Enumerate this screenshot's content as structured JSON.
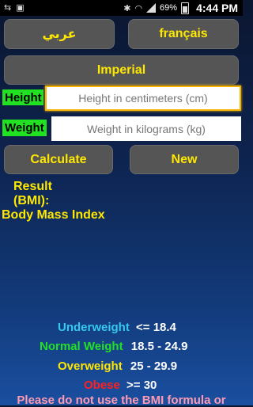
{
  "status_bar": {
    "battery_percent": "69%",
    "time": "4:44 PM"
  },
  "buttons": {
    "arabic": "عربي",
    "french": "français",
    "imperial": "Imperial",
    "calculate": "Calculate",
    "new": "New"
  },
  "fields": {
    "height_label": "Height",
    "height_placeholder": "Height in centimeters (cm)",
    "weight_label": "Weight",
    "weight_placeholder": "Weight in kilograms (kg)"
  },
  "result": {
    "line1": "Result",
    "line2": "(BMI):",
    "line3": "Body Mass Index"
  },
  "categories": [
    {
      "name": "Underweight",
      "range": "<= 18.4",
      "color": "#35c8f0"
    },
    {
      "name": "Normal Weight",
      "range": "18.5 - 24.9",
      "color": "#24e024"
    },
    {
      "name": "Overweight",
      "range": "25 - 29.9",
      "color": "#ffe800"
    },
    {
      "name": "Obese",
      "range": ">= 30",
      "color": "#ff2020"
    }
  ],
  "warning": "Please do not use the BMI formula or"
}
